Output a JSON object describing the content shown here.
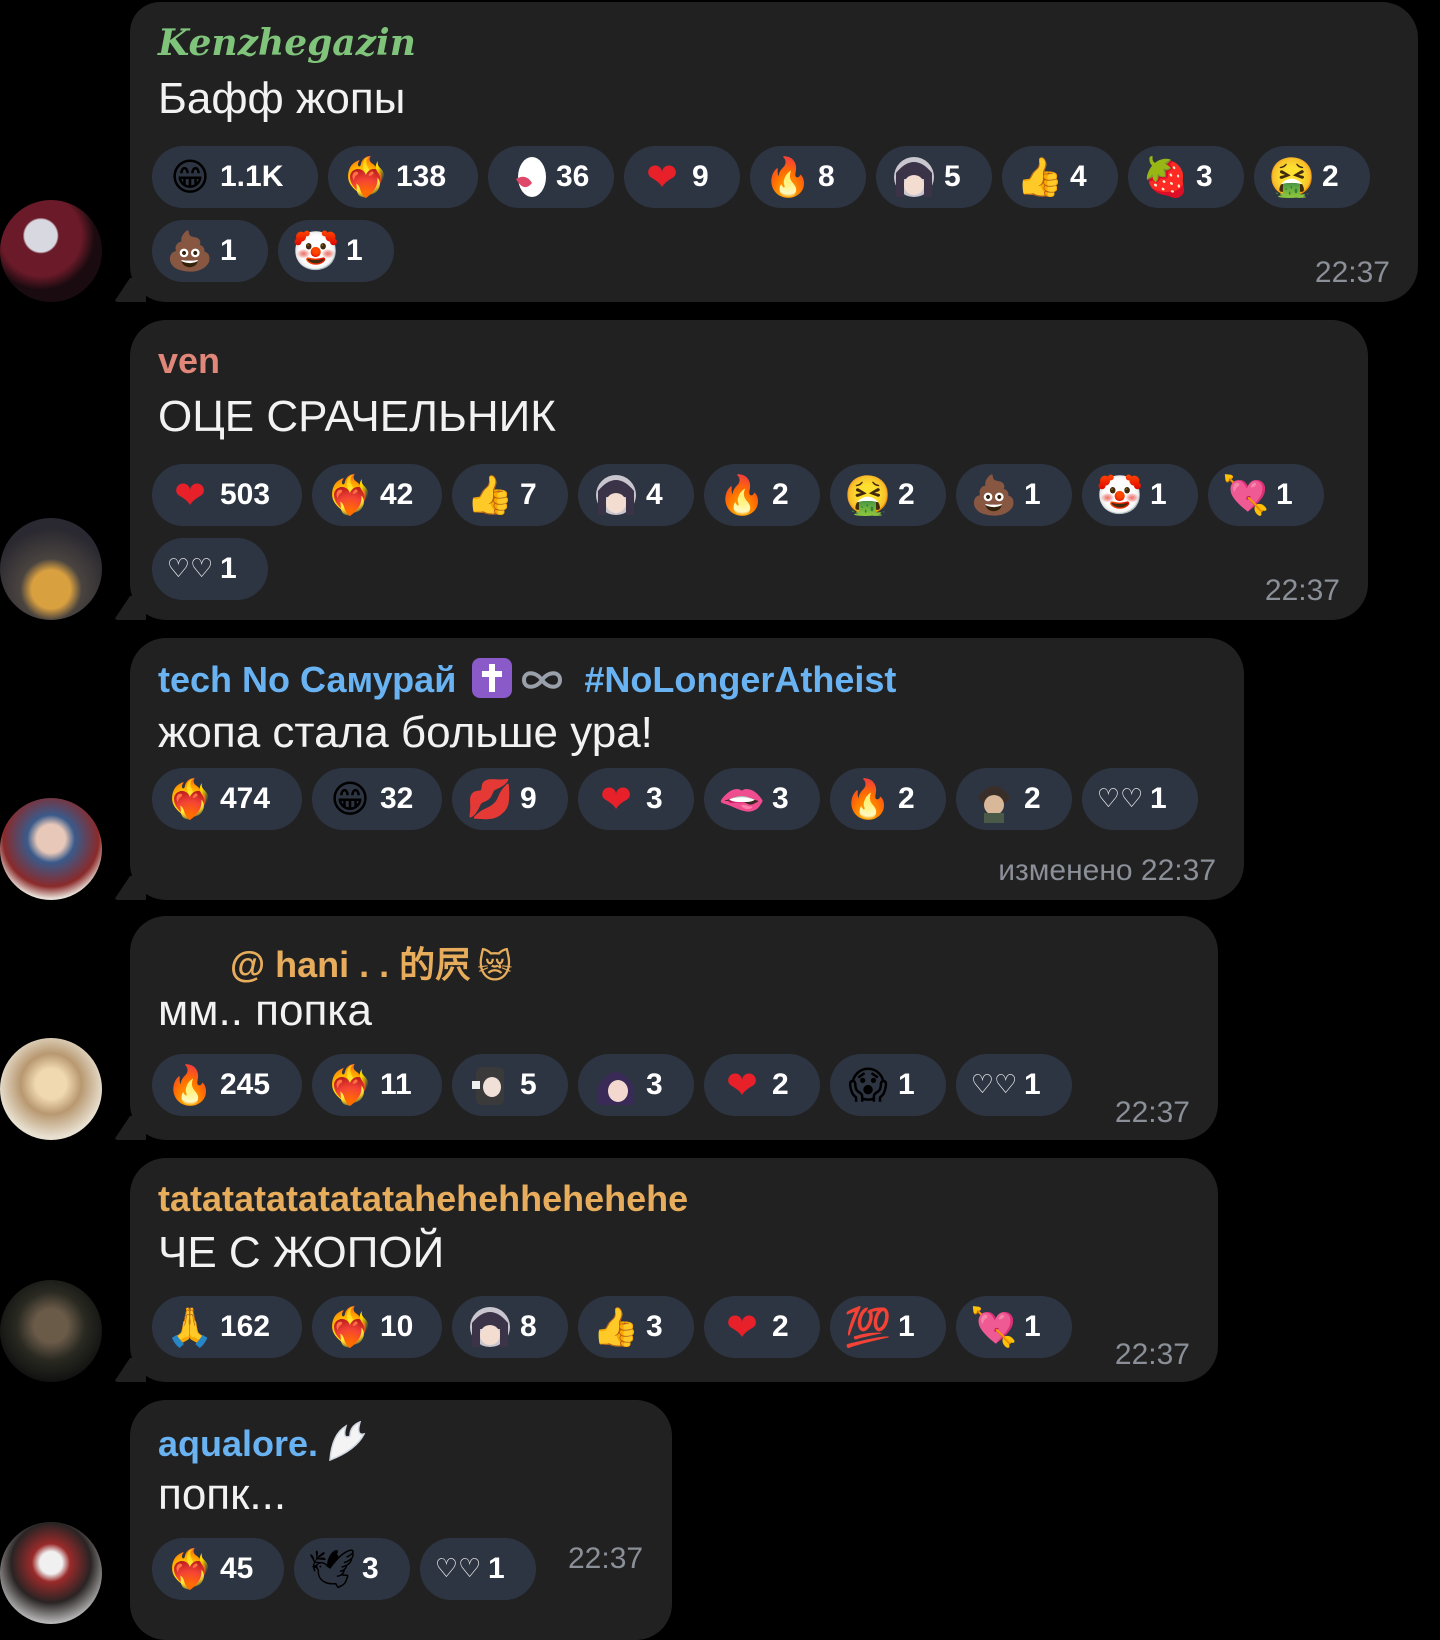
{
  "colors": {
    "background": "#000000",
    "bubble": "#212121",
    "chip": "#2e3542",
    "time": "#8a8f98",
    "name_green": "#7fc47a",
    "name_red": "#e0877a",
    "name_blue": "#6ab3f3",
    "name_orange": "#e7ad5d"
  },
  "messages": [
    {
      "sender": "Kenzhegazin",
      "text": "Бафф жопы",
      "time": "22:37",
      "reactions": [
        {
          "icon": "grinning-face-icon",
          "count": "1.1K"
        },
        {
          "icon": "heart-on-fire-icon",
          "count": "138"
        },
        {
          "icon": "custom-sticker-tongue-icon",
          "count": "36"
        },
        {
          "icon": "red-heart-icon",
          "count": "9"
        },
        {
          "icon": "fire-icon",
          "count": "8"
        },
        {
          "icon": "custom-anime-girl-icon",
          "count": "5"
        },
        {
          "icon": "thumbs-up-icon",
          "count": "4"
        },
        {
          "icon": "strawberry-icon",
          "count": "3"
        },
        {
          "icon": "vomiting-face-icon",
          "count": "2"
        },
        {
          "icon": "poop-icon",
          "count": "1"
        },
        {
          "icon": "clown-face-icon",
          "count": "1"
        }
      ]
    },
    {
      "sender": "ven",
      "text": "ОЦЕ СРАЧЕЛЬНИК",
      "time": "22:37",
      "reactions": [
        {
          "icon": "red-heart-icon",
          "count": "503"
        },
        {
          "icon": "heart-on-fire-icon",
          "count": "42"
        },
        {
          "icon": "thumbs-up-icon",
          "count": "7"
        },
        {
          "icon": "custom-anime-girl-icon",
          "count": "4"
        },
        {
          "icon": "fire-icon",
          "count": "2"
        },
        {
          "icon": "vomiting-face-icon",
          "count": "2"
        },
        {
          "icon": "poop-icon",
          "count": "1"
        },
        {
          "icon": "clown-face-icon",
          "count": "1"
        },
        {
          "icon": "heart-with-arrow-icon",
          "count": "1"
        },
        {
          "icon": "white-hearts-icon",
          "count": "1"
        }
      ]
    },
    {
      "sender": "tech No Самурай",
      "sender_suffix": "#NoLongerAtheist",
      "text": "жопа стала больше ура!",
      "time": "изменено 22:37",
      "reactions": [
        {
          "icon": "heart-on-fire-icon",
          "count": "474"
        },
        {
          "icon": "grinning-face-icon",
          "count": "32"
        },
        {
          "icon": "kiss-mark-icon",
          "count": "9"
        },
        {
          "icon": "red-heart-icon",
          "count": "3"
        },
        {
          "icon": "biting-lip-icon",
          "count": "3"
        },
        {
          "icon": "fire-icon",
          "count": "2"
        },
        {
          "icon": "custom-anime-boy-icon",
          "count": "2"
        },
        {
          "icon": "white-hearts-icon",
          "count": "1"
        }
      ]
    },
    {
      "sender": "@ hani . . 的屄",
      "text": "мм.. попка",
      "time": "22:37",
      "reactions": [
        {
          "icon": "fire-icon",
          "count": "245"
        },
        {
          "icon": "heart-on-fire-icon",
          "count": "11"
        },
        {
          "icon": "custom-chibi-icon",
          "count": "5"
        },
        {
          "icon": "custom-anime-purple-icon",
          "count": "3"
        },
        {
          "icon": "red-heart-icon",
          "count": "2"
        },
        {
          "icon": "screaming-face-icon",
          "count": "1"
        },
        {
          "icon": "white-hearts-icon",
          "count": "1"
        }
      ]
    },
    {
      "sender": "tatatatatatatatahehehhehehehe",
      "text": "ЧЕ С ЖОПОЙ",
      "time": "22:37",
      "reactions": [
        {
          "icon": "folded-hands-icon",
          "count": "162"
        },
        {
          "icon": "heart-on-fire-icon",
          "count": "10"
        },
        {
          "icon": "custom-anime-girl-icon",
          "count": "8"
        },
        {
          "icon": "thumbs-up-icon",
          "count": "3"
        },
        {
          "icon": "red-heart-icon",
          "count": "2"
        },
        {
          "icon": "hundred-points-icon",
          "count": "1"
        },
        {
          "icon": "heart-with-arrow-icon",
          "count": "1"
        }
      ]
    },
    {
      "sender": "aqualore.",
      "text": "попк...",
      "time": "22:37",
      "reactions": [
        {
          "icon": "heart-on-fire-icon",
          "count": "45"
        },
        {
          "icon": "dove-icon",
          "count": "3"
        },
        {
          "icon": "white-hearts-icon",
          "count": "1"
        }
      ]
    }
  ]
}
